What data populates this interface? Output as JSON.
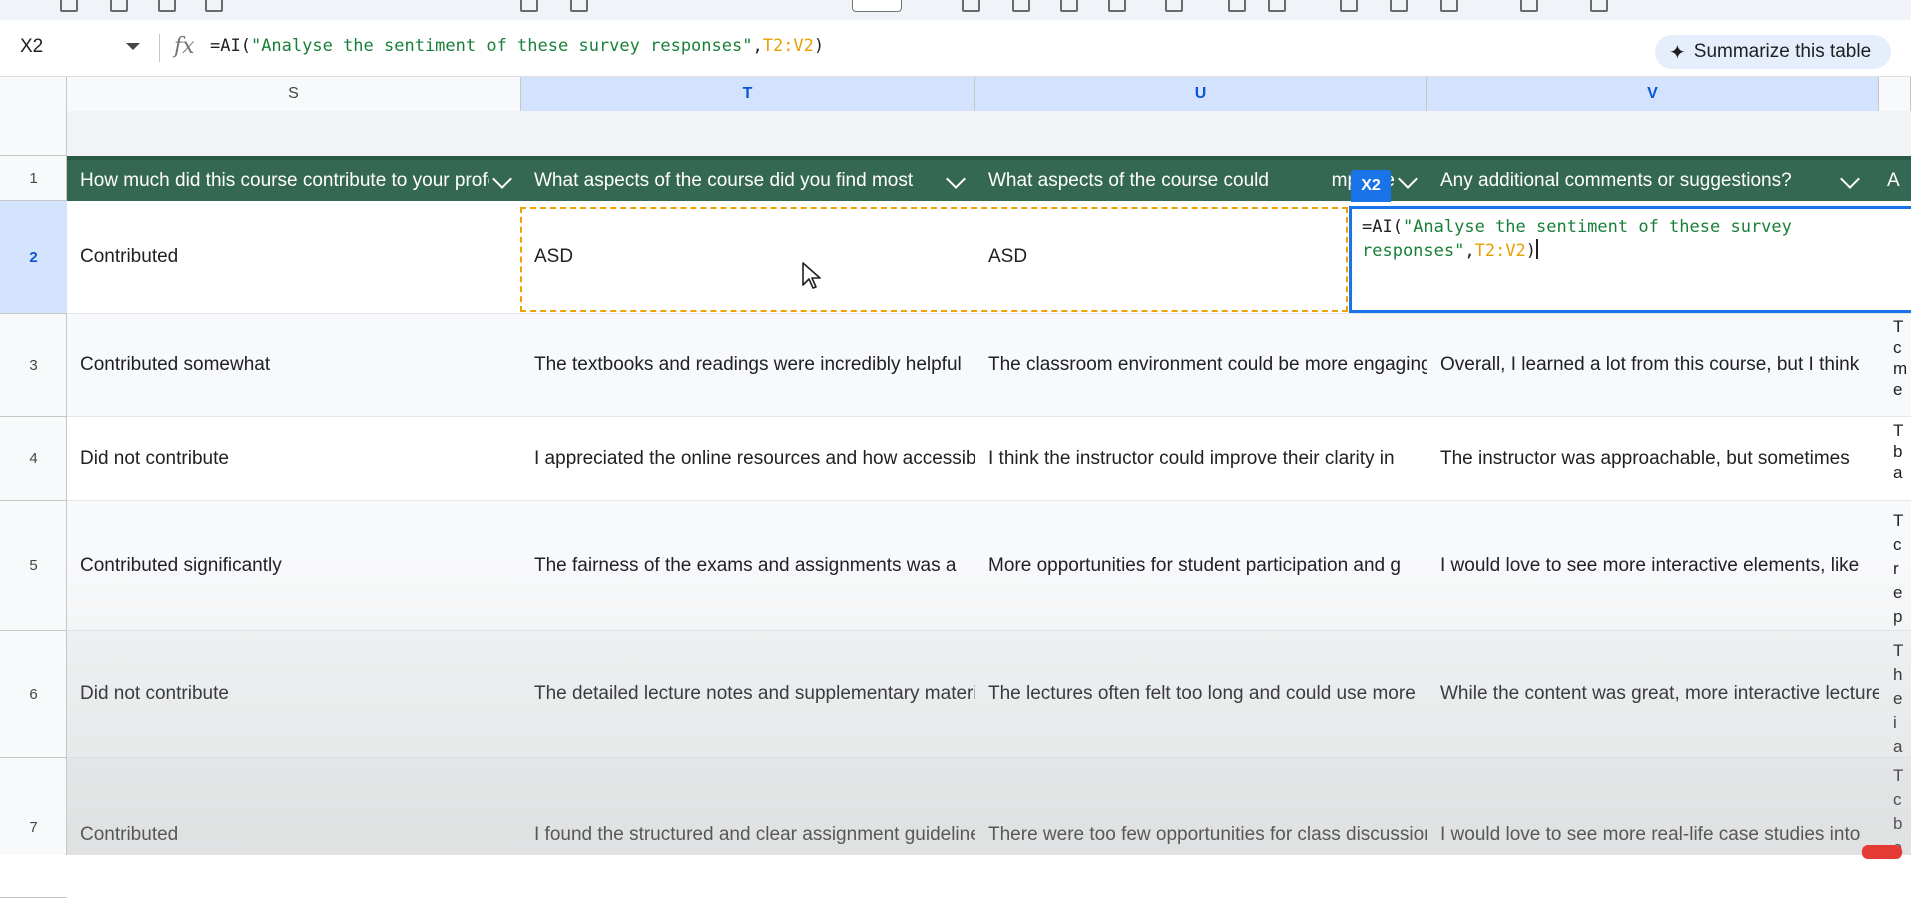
{
  "name_box": "X2",
  "formula": {
    "prefix": "=AI(",
    "string": "\"Analyse the sentiment of these survey responses\"",
    "comma": ",",
    "range": "T2:V2",
    "suffix": ")"
  },
  "summarize_button": "Summarize this table",
  "columns": [
    "S",
    "T",
    "U",
    "V"
  ],
  "rows": [
    "1",
    "2",
    "3",
    "4",
    "5",
    "6",
    "7"
  ],
  "header_row": [
    "How much did this course contribute to your profe",
    "What aspects of the course did you find most",
    "What aspects of the course could",
    "mprove",
    "Any additional comments or suggestions?",
    "A"
  ],
  "active_cell_tag": "X2",
  "editor": {
    "line1_prefix": "=AI(",
    "line1_string": "\"Analyse the sentiment of these survey",
    "line2_string": "responses\"",
    "comma": ",",
    "range": "T2:V2",
    "suffix": ")"
  },
  "data_rows": [
    {
      "s": "Contributed",
      "t": "ASD",
      "u": "ASD",
      "v": "",
      "w": ""
    },
    {
      "s": "Contributed somewhat",
      "t": "The textbooks and readings were incredibly helpful",
      "u": "The classroom environment could be more engaging",
      "v": "Overall, I learned a lot from this course, but I think",
      "w": "T\nc\nm\ne"
    },
    {
      "s": "Did not contribute",
      "t": "I appreciated the online resources and how accessible",
      "u": "I think the instructor could improve their clarity in",
      "v": "The instructor was approachable, but sometimes",
      "w": "T\nb\na"
    },
    {
      "s": "Contributed significantly",
      "t": "The fairness of the exams and assignments was a",
      "u": "More opportunities for student participation and g",
      "v": "I would love to see more interactive elements, like",
      "w": "T\nc\nr\ne\np"
    },
    {
      "s": "Did not contribute",
      "t": "The detailed lecture notes and supplementary materials",
      "u": "The lectures often felt too long and could use more",
      "v": "While the content was great, more interactive lectures",
      "w": "T\nh\ne\ni\na"
    },
    {
      "s": "Contributed",
      "t": "I found the structured and clear assignment guidelines",
      "u": "There were too few opportunities for class discussion",
      "v": "I would love to see more real-life case studies into",
      "w": "T\nc\nb\na"
    }
  ]
}
